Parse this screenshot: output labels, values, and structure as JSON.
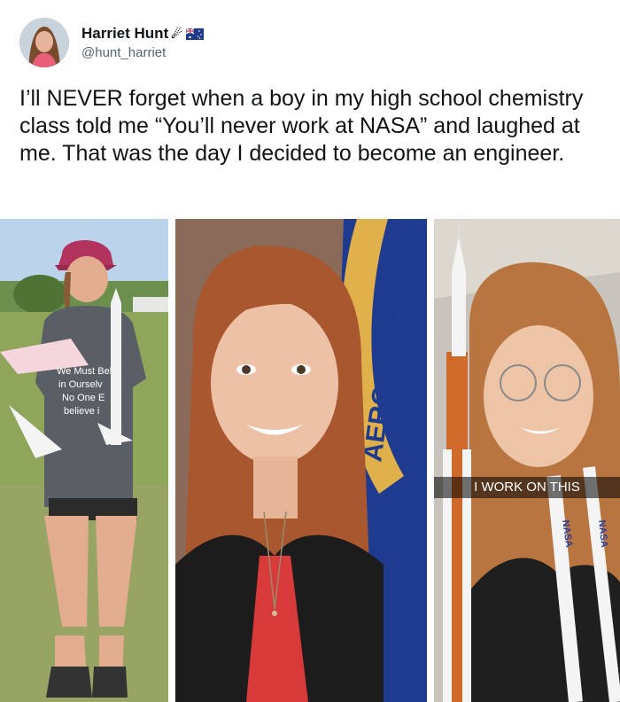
{
  "author": {
    "display_name": "Harriet Hunt",
    "handle": "@hunt_harriet",
    "name_emoji": "☄",
    "flag_icon": "australia-flag-icon"
  },
  "tweet": {
    "text": "I’ll NEVER forget when a boy in my high school chemistry class told me “You’ll never work at NASA” and laughed at me. That was the day I decided to become an engineer."
  },
  "photos": [
    {
      "position": "left",
      "subject": "woman holding model rocket",
      "shirt_text": [
        "We Must Bel",
        "in Ourselv",
        "No One E",
        "believe i"
      ]
    },
    {
      "position": "center",
      "subject": "portrait in front of NASA flag",
      "flag_text": "AERONAUTICS"
    },
    {
      "position": "right",
      "subject": "selfie with rocket model",
      "caption": "I WORK ON THIS",
      "lanyard_text": "NASA"
    }
  ],
  "colors": {
    "text": "#0f1419",
    "handle": "#536471",
    "nasa_blue": "#1e3b8f",
    "flag_gold": "#e0b14a"
  }
}
